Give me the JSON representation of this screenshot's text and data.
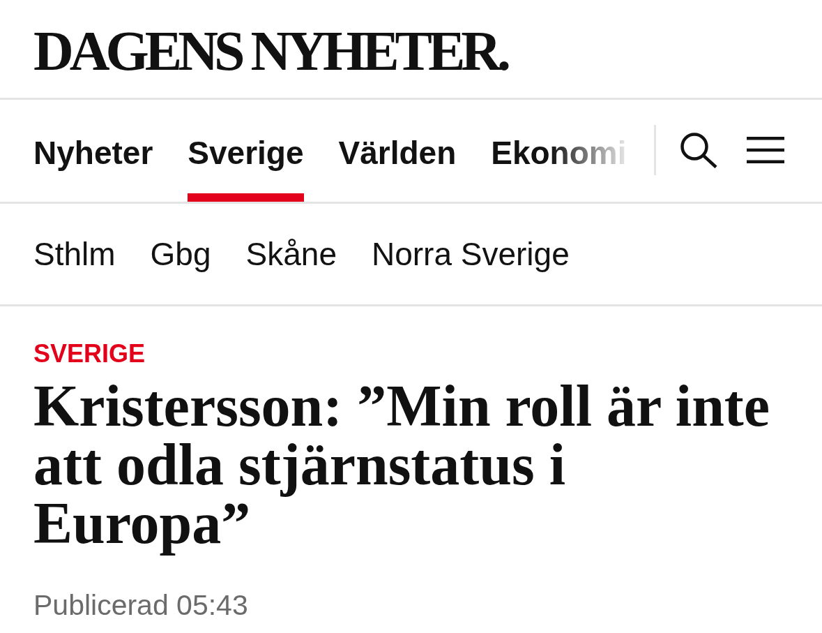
{
  "logo": {
    "text": "DAGENS NYHETER."
  },
  "main_nav": [
    {
      "label": "Nyheter",
      "selected": false
    },
    {
      "label": "Sverige",
      "selected": true
    },
    {
      "label": "Världen",
      "selected": false
    },
    {
      "label": "Ekonomi",
      "selected": false
    }
  ],
  "sub_nav": [
    {
      "label": "Sthlm"
    },
    {
      "label": "Gbg"
    },
    {
      "label": "Skåne"
    },
    {
      "label": "Norra Sverige"
    }
  ],
  "article": {
    "section": "SVERIGE",
    "headline": "Kristersson: ”Min roll är inte att odla stjärnstatus i Europa”",
    "published": "Publicerad 05:43"
  }
}
